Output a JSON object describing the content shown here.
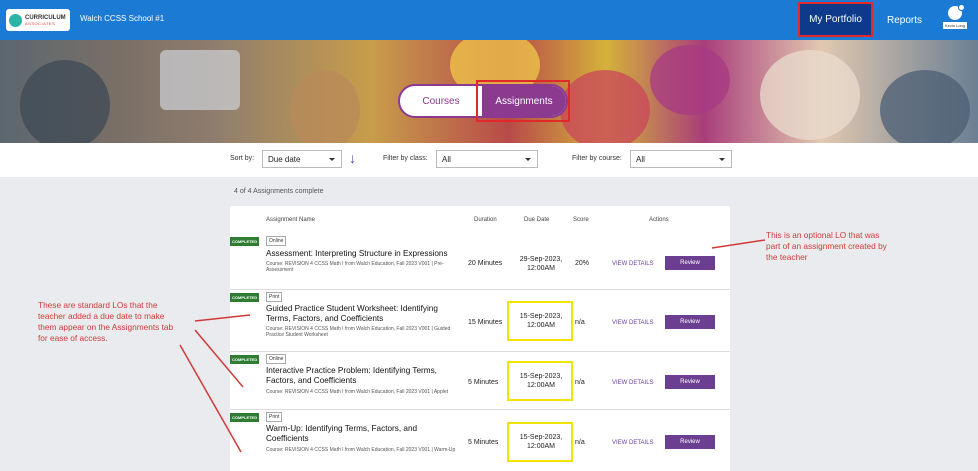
{
  "topbar": {
    "logo_name": "CURRICULUM",
    "logo_sub": "ASSOCIATES",
    "school": "Walch CCSS School #1",
    "portfolio": "My Portfolio",
    "reports": "Reports",
    "user_name": "Kevin Long"
  },
  "toggle": {
    "courses": "Courses",
    "assignments": "Assignments"
  },
  "filters": {
    "sort_label": "Sort by:",
    "sort_value": "Due date",
    "class_label": "Filter by class:",
    "class_value": "All",
    "course_label": "Filter by course:",
    "course_value": "All"
  },
  "summary": "4 of 4 Assignments complete",
  "columns": {
    "name": "Assignment Name",
    "duration": "Duration",
    "due": "Due Date",
    "score": "Score",
    "actions": "Actions"
  },
  "rows": [
    {
      "status": "COMPLETED",
      "type": "Online",
      "title": "Assessment: Interpreting Structure in Expressions",
      "course": "Course: REVISION 4 CCSS Math I from Walch Education, Fall 2023 V001 | Pre-Assessment",
      "duration": "20 Minutes",
      "due1": "29-Sep-2023,",
      "due2": "12:00AM",
      "score": "20%",
      "view": "VIEW DETAILS",
      "action": "Review"
    },
    {
      "status": "COMPLETED",
      "type": "Print",
      "title": "Guided Practice Student Worksheet: Identifying Terms, Factors, and Coefficients",
      "course": "Course: REVISION 4 CCSS Math I from Walch Education, Fall 2023 V001 | Guided Practice Student Worksheet",
      "duration": "15 Minutes",
      "due1": "15-Sep-2023,",
      "due2": "12:00AM",
      "score": "n/a",
      "view": "VIEW DETAILS",
      "action": "Review"
    },
    {
      "status": "COMPLETED",
      "type": "Online",
      "title": "Interactive Practice Problem: Identifying Terms, Factors, and Coefficients",
      "course": "Course: REVISION 4 CCSS Math I from Walch Education, Fall 2023 V001 | Applet",
      "duration": "5 Minutes",
      "due1": "15-Sep-2023,",
      "due2": "12:00AM",
      "score": "n/a",
      "view": "VIEW DETAILS",
      "action": "Review"
    },
    {
      "status": "COMPLETED",
      "type": "Print",
      "title": "Warm-Up: Identifying Terms, Factors, and Coefficients",
      "course": "Course: REVISION 4 CCSS Math I from Walch Education, Fall 2023 V001 | Warm-Up",
      "duration": "5 Minutes",
      "due1": "15-Sep-2023,",
      "due2": "12:00AM",
      "score": "n/a",
      "view": "VIEW DETAILS",
      "action": "Review"
    }
  ],
  "notes": {
    "left": "These are standard LOs that the teacher added a due date to make them appear on the Assignments tab for ease of access.",
    "right": "This is an optional LO that was part of an assignment created by the teacher"
  },
  "colors": {
    "topbar": "#1b7ad3",
    "accent": "#8b3a8f",
    "review": "#6b3e91",
    "completed": "#2e7d32",
    "annotation": "#d23a3a",
    "highlight": "#f2e400"
  }
}
